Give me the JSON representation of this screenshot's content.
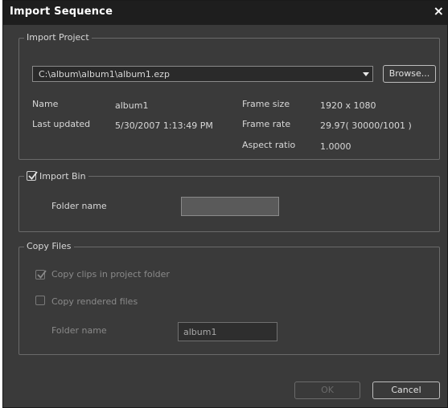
{
  "window": {
    "title": "Import Sequence",
    "close_symbol": "×"
  },
  "import_project": {
    "legend": "Import Project",
    "path_value": "C:\\album\\album1\\album1.ezp",
    "browse_label": "Browse...",
    "fields": {
      "name_label": "Name",
      "name_value": "album1",
      "last_updated_label": "Last updated",
      "last_updated_value": "5/30/2007 1:13:49 PM",
      "frame_size_label": "Frame size",
      "frame_size_value": "1920 x 1080",
      "frame_rate_label": "Frame rate",
      "frame_rate_value": "29.97( 30000/1001 )",
      "aspect_ratio_label": "Aspect ratio",
      "aspect_ratio_value": "1.0000"
    }
  },
  "import_bin": {
    "legend": "Import Bin",
    "checked": true,
    "folder_label": "Folder name",
    "folder_value": ""
  },
  "copy_files": {
    "legend": "Copy Files",
    "copy_clips_label": "Copy clips in project folder",
    "copy_clips_checked": true,
    "copy_rendered_label": "Copy rendered files",
    "copy_rendered_checked": false,
    "folder_label": "Folder name",
    "folder_value": "album1"
  },
  "footer": {
    "ok_label": "OK",
    "cancel_label": "Cancel"
  }
}
